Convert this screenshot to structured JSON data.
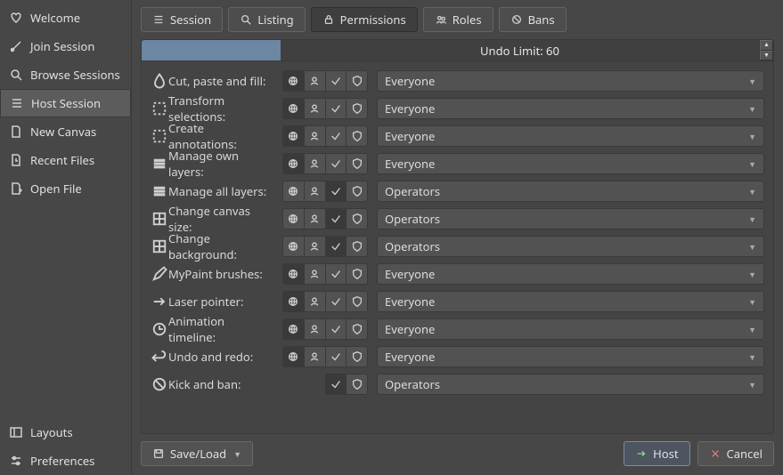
{
  "sidebar": {
    "items": [
      {
        "label": "Welcome",
        "icon": "heart-icon"
      },
      {
        "label": "Join Session",
        "icon": "brush-icon"
      },
      {
        "label": "Browse Sessions",
        "icon": "search-icon"
      },
      {
        "label": "Host Session",
        "icon": "list-icon",
        "active": true
      },
      {
        "label": "New Canvas",
        "icon": "page-icon"
      },
      {
        "label": "Recent Files",
        "icon": "recent-icon"
      },
      {
        "label": "Open File",
        "icon": "folder-icon"
      }
    ],
    "bottom": [
      {
        "label": "Layouts",
        "icon": "layouts-icon"
      },
      {
        "label": "Preferences",
        "icon": "sliders-icon"
      }
    ]
  },
  "tabs": [
    {
      "label": "Session",
      "icon": "list-icon"
    },
    {
      "label": "Listing",
      "icon": "search-icon"
    },
    {
      "label": "Permissions",
      "icon": "lock-icon",
      "active": true
    },
    {
      "label": "Roles",
      "icon": "roles-icon"
    },
    {
      "label": "Bans",
      "icon": "bans-icon"
    }
  ],
  "undo": {
    "label": "Undo Limit: 60"
  },
  "perm_options": {
    "everyone": "Everyone",
    "operators": "Operators"
  },
  "permissions": [
    {
      "icon": "fill-icon",
      "label": "Cut, paste and fill:",
      "value": "everyone",
      "seg": "globe"
    },
    {
      "icon": "transform-icon",
      "label": "Transform selections:",
      "value": "everyone",
      "seg": "globe"
    },
    {
      "icon": "annot-icon",
      "label": "Create annotations:",
      "value": "everyone",
      "seg": "globe"
    },
    {
      "icon": "layers-icon",
      "label": "Manage own layers:",
      "value": "everyone",
      "seg": "globe"
    },
    {
      "icon": "alllayers-icon",
      "label": "Manage all layers:",
      "value": "operators",
      "seg": "check"
    },
    {
      "icon": "resize-icon",
      "label": "Change canvas size:",
      "value": "operators",
      "seg": "check"
    },
    {
      "icon": "bg-icon",
      "label": "Change background:",
      "value": "operators",
      "seg": "check"
    },
    {
      "icon": "mypaint-icon",
      "label": "MyPaint brushes:",
      "value": "everyone",
      "seg": "globe"
    },
    {
      "icon": "laser-icon",
      "label": "Laser pointer:",
      "value": "everyone",
      "seg": "globe"
    },
    {
      "icon": "timeline-icon",
      "label": "Animation timeline:",
      "value": "everyone",
      "seg": "globe"
    },
    {
      "icon": "undo-icon",
      "label": "Undo and redo:",
      "value": "everyone",
      "seg": "globe"
    },
    {
      "icon": "kick-icon",
      "label": "Kick and ban:",
      "value": "operators",
      "seg": "check",
      "hide_globe_user": true
    }
  ],
  "footer": {
    "saveload": "Save/Load",
    "host": "Host",
    "cancel": "Cancel"
  }
}
